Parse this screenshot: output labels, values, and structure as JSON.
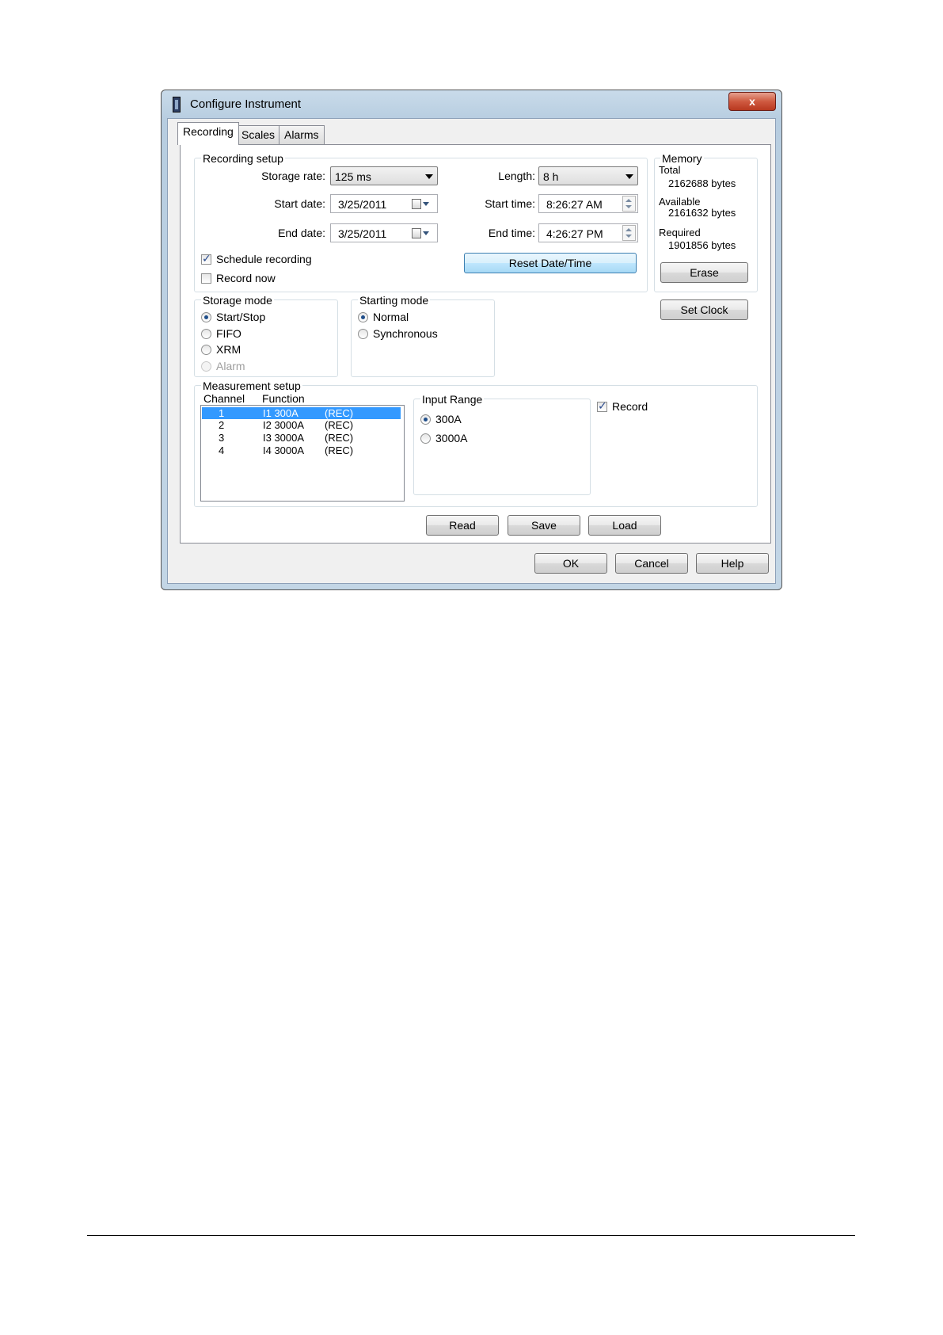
{
  "window": {
    "title": "Configure Instrument",
    "close_label": "x"
  },
  "tabs": [
    {
      "label": "Recording",
      "active": true
    },
    {
      "label": "Scales",
      "active": false
    },
    {
      "label": "Alarms",
      "active": false
    }
  ],
  "recording_setup": {
    "group_label": "Recording setup",
    "storage_rate_label": "Storage rate:",
    "storage_rate_value": "125 ms",
    "length_label": "Length:",
    "length_value": "8 h",
    "start_date_label": "Start date:",
    "start_date_value": "3/25/2011",
    "start_time_label": "Start time:",
    "start_time_value": "8:26:27 AM",
    "end_date_label": "End date:",
    "end_date_value": "3/25/2011",
    "end_time_label": "End time:",
    "end_time_value": "4:26:27 PM",
    "schedule_recording_label": "Schedule recording",
    "schedule_recording_checked": true,
    "record_now_label": "Record now",
    "record_now_checked": false,
    "reset_button": "Reset Date/Time"
  },
  "memory": {
    "group_label": "Memory",
    "total_label": "Total",
    "total_value": "2162688 bytes",
    "available_label": "Available",
    "available_value": "2161632 bytes",
    "required_label": "Required",
    "required_value": "1901856 bytes",
    "erase_button": "Erase",
    "set_clock_button": "Set Clock"
  },
  "storage_mode": {
    "group_label": "Storage mode",
    "options": [
      {
        "label": "Start/Stop",
        "selected": true,
        "enabled": true
      },
      {
        "label": "FIFO",
        "selected": false,
        "enabled": true
      },
      {
        "label": "XRM",
        "selected": false,
        "enabled": true
      },
      {
        "label": "Alarm",
        "selected": false,
        "enabled": false
      }
    ]
  },
  "starting_mode": {
    "group_label": "Starting mode",
    "options": [
      {
        "label": "Normal",
        "selected": true
      },
      {
        "label": "Synchronous",
        "selected": false
      }
    ]
  },
  "measurement_setup": {
    "group_label": "Measurement setup",
    "column_channel": "Channel",
    "column_function": "Function",
    "rows": [
      {
        "channel": "1",
        "function": "I1 300A",
        "status": "(REC)",
        "selected": true
      },
      {
        "channel": "2",
        "function": "I2 3000A",
        "status": "(REC)",
        "selected": false
      },
      {
        "channel": "3",
        "function": "I3 3000A",
        "status": "(REC)",
        "selected": false
      },
      {
        "channel": "4",
        "function": "I4 3000A",
        "status": "(REC)",
        "selected": false
      }
    ],
    "input_range": {
      "group_label": "Input Range",
      "options": [
        {
          "label": "300A",
          "selected": true
        },
        {
          "label": "3000A",
          "selected": false
        }
      ]
    },
    "record_label": "Record",
    "record_checked": true
  },
  "page_buttons": {
    "read": "Read",
    "save": "Save",
    "load": "Load"
  },
  "dialog_buttons": {
    "ok": "OK",
    "cancel": "Cancel",
    "help": "Help"
  },
  "colors": {
    "selection": "#3399ff",
    "window_frame": "#b7cde0",
    "close_button": "#cf5a40"
  }
}
